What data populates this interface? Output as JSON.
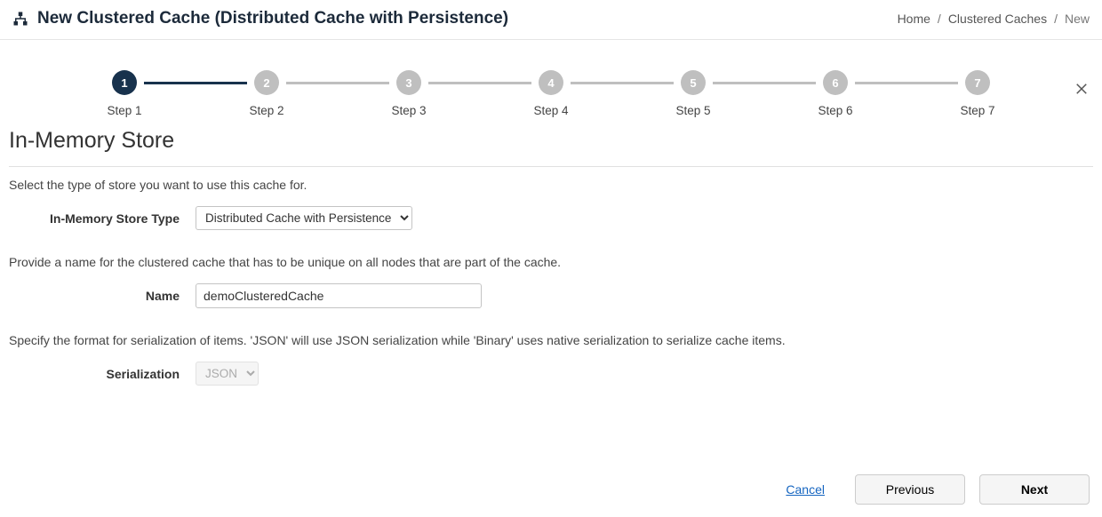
{
  "header": {
    "title": "New Clustered Cache (Distributed Cache with Persistence)",
    "breadcrumbs": [
      "Home",
      "Clustered Caches",
      "New"
    ]
  },
  "wizard": {
    "steps": [
      {
        "num": "1",
        "label": "Step 1",
        "active": true
      },
      {
        "num": "2",
        "label": "Step 2",
        "active": false
      },
      {
        "num": "3",
        "label": "Step 3",
        "active": false
      },
      {
        "num": "4",
        "label": "Step 4",
        "active": false
      },
      {
        "num": "5",
        "label": "Step 5",
        "active": false
      },
      {
        "num": "6",
        "label": "Step 6",
        "active": false
      },
      {
        "num": "7",
        "label": "Step 7",
        "active": false
      }
    ],
    "section_title": "In-Memory Store",
    "store_desc": "Select the type of store you want to use this cache for.",
    "store_label": "In-Memory Store Type",
    "store_value": "Distributed Cache with Persistence",
    "name_desc": "Provide a name for the clustered cache that has to be unique on all nodes that are part of the cache.",
    "name_label": "Name",
    "name_value": "demoClusteredCache",
    "serialization_desc": "Specify the format for serialization of items. 'JSON' will use JSON serialization while 'Binary' uses native serialization to serialize cache items.",
    "serialization_label": "Serialization",
    "serialization_value": "JSON"
  },
  "footer": {
    "cancel": "Cancel",
    "previous": "Previous",
    "next": "Next"
  }
}
